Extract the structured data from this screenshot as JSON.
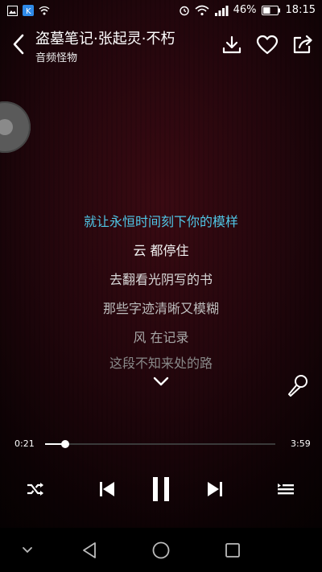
{
  "status_bar": {
    "battery_percent": "46%",
    "time": "18:15",
    "icons": [
      "gallery-icon",
      "k-app-icon",
      "network-icon",
      "alarm-icon",
      "wifi-icon",
      "signal-icon",
      "battery-icon"
    ]
  },
  "header": {
    "song_title": "盗墓笔记·张起灵·不朽",
    "artist": "音频怪物"
  },
  "lyrics": {
    "current": "就让永恒时间刻下你的模样",
    "lines": [
      "云 都停住",
      "去翻看光阴写的书",
      "那些字迹清晰又模糊",
      "风 在记录",
      "这段不知来处的路"
    ]
  },
  "player": {
    "elapsed": "0:21",
    "duration": "3:59",
    "progress_fraction": 0.088
  },
  "colors": {
    "accent_lyric": "#4fc6e6",
    "background": "#22060c"
  }
}
